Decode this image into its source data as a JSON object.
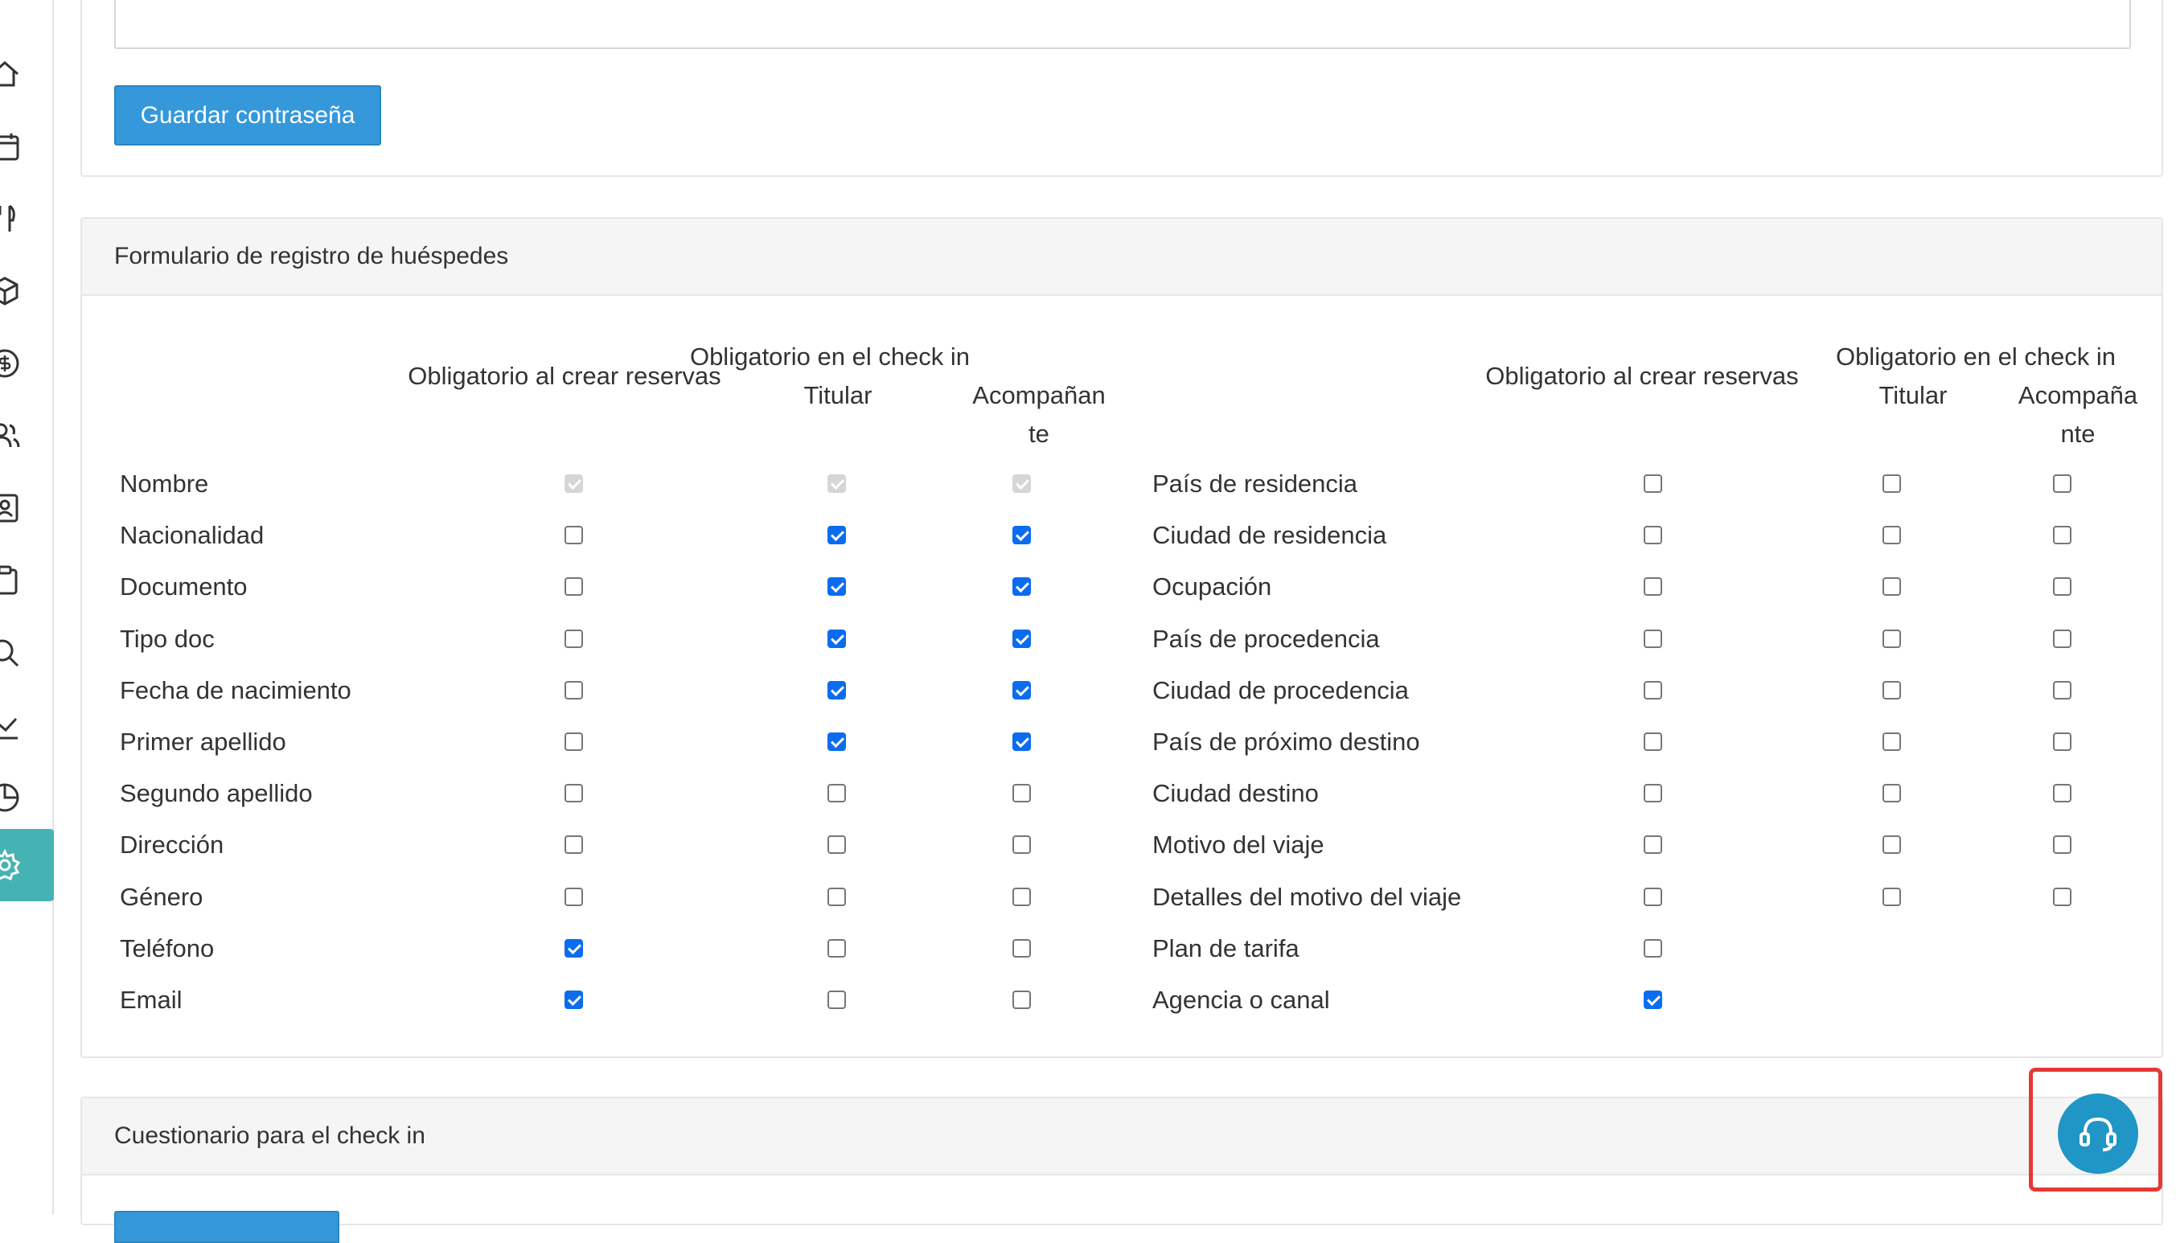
{
  "sidebar": {
    "items": [
      {
        "icon": "home-icon"
      },
      {
        "icon": "calendar-icon"
      },
      {
        "icon": "restaurant-icon"
      },
      {
        "icon": "package-icon"
      },
      {
        "icon": "money-icon"
      },
      {
        "icon": "users-icon"
      },
      {
        "icon": "contact-card-icon"
      },
      {
        "icon": "clipboard-icon"
      },
      {
        "icon": "search-icon"
      },
      {
        "icon": "line-chart-icon"
      },
      {
        "icon": "pie-chart-icon"
      },
      {
        "icon": "settings-icon",
        "active": true
      }
    ],
    "active_color": "#45b3b3"
  },
  "password_section": {
    "save_button": "Guardar contraseña",
    "button_color": "#3498db"
  },
  "guest_form": {
    "title": "Formulario de registro de huéspedes",
    "headers": {
      "create_required": "Obligatorio al crear reservas",
      "checkin_required": "Obligatorio en el check in",
      "holder": "Titular",
      "companion_left": [
        "Acompañan",
        "te"
      ],
      "companion_right": [
        "Acompaña",
        "nte"
      ]
    },
    "left_rows": [
      {
        "label": "Nombre",
        "create": "disabled",
        "holder": "disabled",
        "companion": "disabled"
      },
      {
        "label": "Nacionalidad",
        "create": false,
        "holder": true,
        "companion": true
      },
      {
        "label": "Documento",
        "create": false,
        "holder": true,
        "companion": true
      },
      {
        "label": "Tipo doc",
        "create": false,
        "holder": true,
        "companion": true
      },
      {
        "label": "Fecha de nacimiento",
        "create": false,
        "holder": true,
        "companion": true
      },
      {
        "label": "Primer apellido",
        "create": false,
        "holder": true,
        "companion": true
      },
      {
        "label": "Segundo apellido",
        "create": false,
        "holder": false,
        "companion": false
      },
      {
        "label": "Dirección",
        "create": false,
        "holder": false,
        "companion": false
      },
      {
        "label": "Género",
        "create": false,
        "holder": false,
        "companion": false
      },
      {
        "label": "Teléfono",
        "create": true,
        "holder": false,
        "companion": false
      },
      {
        "label": "Email",
        "create": true,
        "holder": false,
        "companion": false
      }
    ],
    "right_rows": [
      {
        "label": "País de residencia",
        "create": false,
        "holder": false,
        "companion": false
      },
      {
        "label": "Ciudad de residencia",
        "create": false,
        "holder": false,
        "companion": false
      },
      {
        "label": "Ocupación",
        "create": false,
        "holder": false,
        "companion": false
      },
      {
        "label": "País de procedencia",
        "create": false,
        "holder": false,
        "companion": false
      },
      {
        "label": "Ciudad de procedencia",
        "create": false,
        "holder": false,
        "companion": false
      },
      {
        "label": "País de próximo destino",
        "create": false,
        "holder": false,
        "companion": false
      },
      {
        "label": "Ciudad destino",
        "create": false,
        "holder": false,
        "companion": false
      },
      {
        "label": "Motivo del viaje",
        "create": false,
        "holder": false,
        "companion": false
      },
      {
        "label": "Detalles del motivo del viaje",
        "create": false,
        "holder": false,
        "companion": false
      },
      {
        "label": "Plan de tarifa",
        "create": false,
        "holder": null,
        "companion": null
      },
      {
        "label": "Agencia o canal",
        "create": true,
        "holder": null,
        "companion": null
      }
    ]
  },
  "checkin_questionnaire": {
    "title": "Cuestionario para el check in"
  },
  "support_button": {
    "icon": "headset-icon",
    "color": "#1f96c6",
    "highlight_color": "#e53935"
  }
}
